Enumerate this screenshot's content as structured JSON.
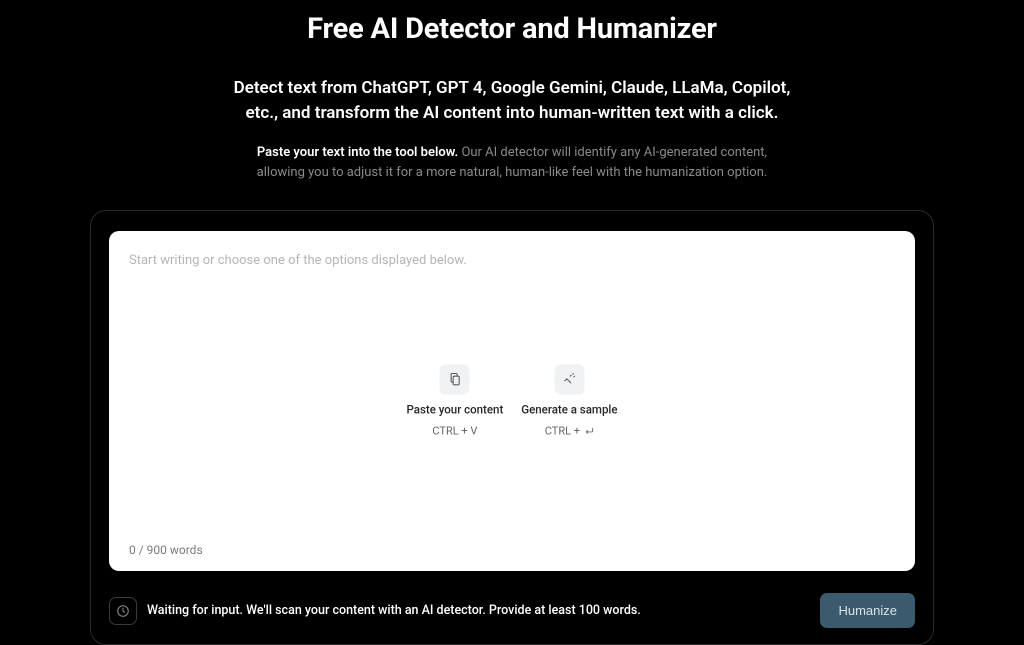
{
  "header": {
    "title": "Free AI Detector and Humanizer",
    "subtitle": "Detect text from ChatGPT, GPT 4, Google Gemini, Claude, LLaMa, Copilot, etc., and transform the AI content into human-written text with a click.",
    "instruction_bold": "Paste your text into the tool below.",
    "instruction_rest": " Our AI detector will identify any AI-generated content, allowing you to adjust it for a more natural, human-like feel with the humanization option."
  },
  "editor": {
    "placeholder": "Start writing or choose one of the options displayed below.",
    "word_count": "0 / 900 words",
    "actions": {
      "paste": {
        "label": "Paste your content",
        "shortcut": "CTRL + V"
      },
      "sample": {
        "label": "Generate a sample",
        "shortcut_prefix": "CTRL + "
      }
    }
  },
  "status": {
    "message": "Waiting for input. We'll scan your content with an AI detector. Provide at least 100 words.",
    "button": "Humanize"
  }
}
